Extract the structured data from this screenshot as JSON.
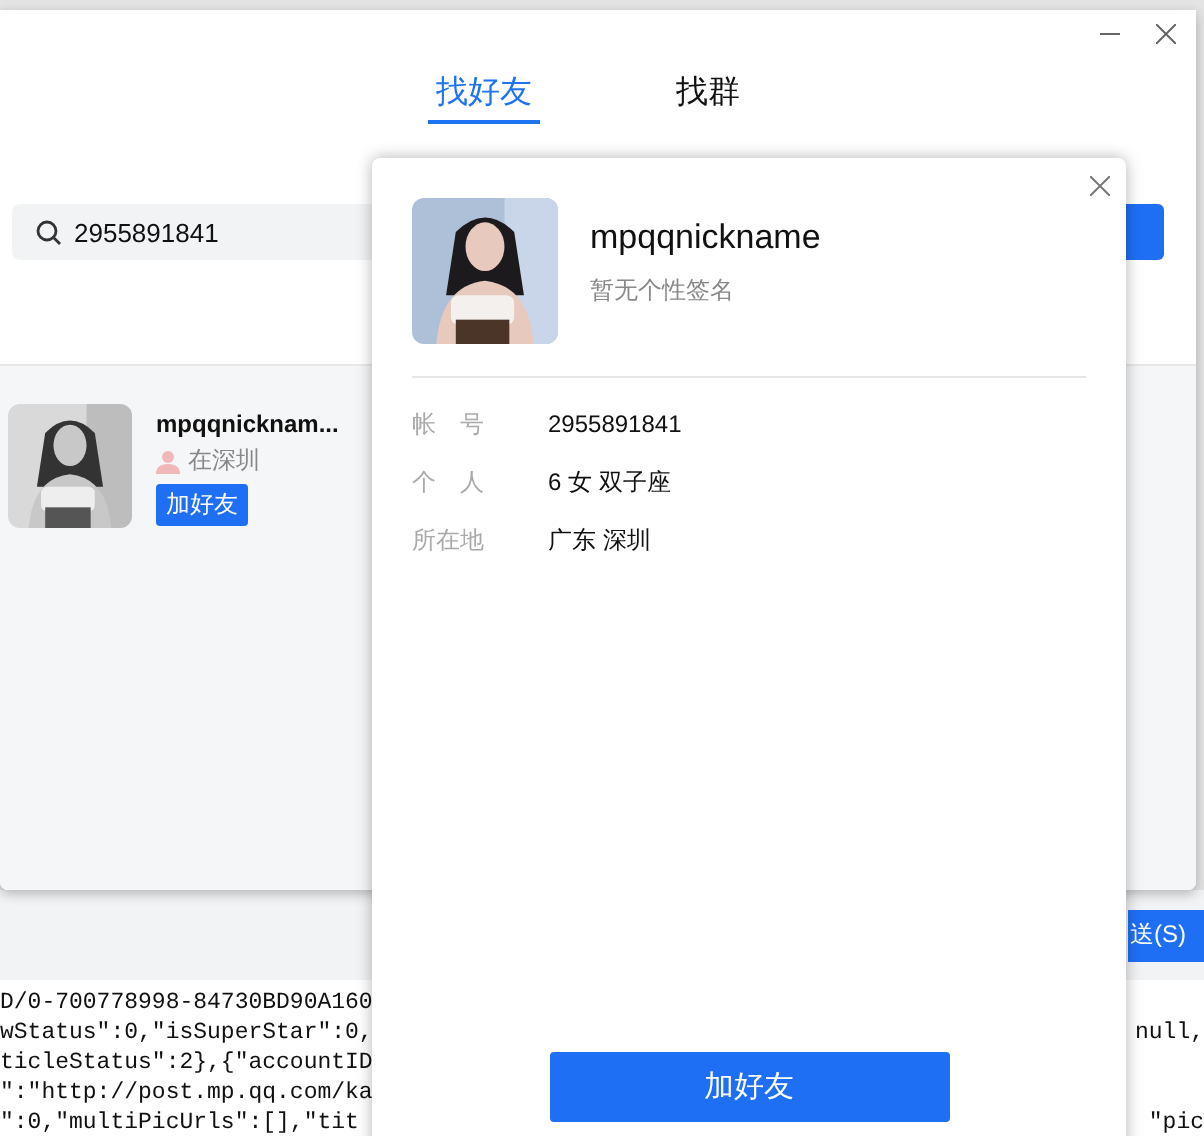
{
  "search_window": {
    "tabs": [
      {
        "label": "找好友",
        "selected": true
      },
      {
        "label": "找群",
        "selected": false
      }
    ],
    "search": {
      "value": "2955891841"
    },
    "results": [
      {
        "name": "mpqqnicknam...",
        "location": "在深圳",
        "add_button": "加好友"
      }
    ]
  },
  "chat_window": {
    "send_button": "送(S)"
  },
  "code_view": {
    "lines": [
      {
        "left": "D/0-700778998-84730BD90A160"
      },
      {
        "left": "wStatus\":0,\"isSuperStar\":0,",
        "right": "null,"
      },
      {
        "left": "ticleStatus\":2},{\"accountID"
      },
      {
        "left": "\":\"http://post.mp.qq.com/ka"
      },
      {
        "left": "\":0,\"multiPicUrls\":[],\"tit",
        "right": "\"pic"
      }
    ]
  },
  "profile_card": {
    "name": "mpqqnickname",
    "signature": "暂无个性签名",
    "fields": [
      {
        "label": "帐　号",
        "value": "2955891841"
      },
      {
        "label": "个　人",
        "value": "6 女 双子座"
      },
      {
        "label": "所在地",
        "value": "广东 深圳"
      }
    ],
    "add_button": "加好友"
  }
}
